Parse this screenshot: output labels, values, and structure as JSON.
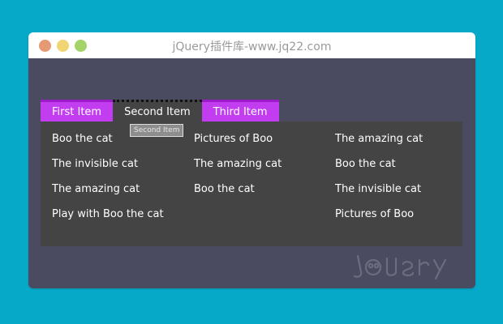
{
  "window": {
    "title": "jQuery插件库-www.jq22.com"
  },
  "tabs": [
    {
      "label": "First Item"
    },
    {
      "label": "Second Item"
    },
    {
      "label": "Third Item"
    }
  ],
  "tooltip": {
    "text": "Second Item"
  },
  "panel": {
    "columns": [
      {
        "items": [
          {
            "label": "Boo the cat"
          },
          {
            "label": "The invisible cat"
          },
          {
            "label": "The amazing cat"
          },
          {
            "label": "Play with Boo the cat"
          }
        ]
      },
      {
        "items": [
          {
            "label": "Pictures of Boo"
          },
          {
            "label": "The amazing cat"
          },
          {
            "label": "Boo the cat"
          }
        ]
      },
      {
        "items": [
          {
            "label": "The amazing cat"
          },
          {
            "label": "Boo the cat"
          },
          {
            "label": "The invisible cat"
          },
          {
            "label": "Pictures of Boo"
          }
        ]
      }
    ]
  },
  "colors": {
    "page_bg": "#07a9c9",
    "content_bg": "#4a4b61",
    "panel_bg": "#444444",
    "tab_bg": "#c33df0",
    "tab_border": "#9d1bc9"
  }
}
